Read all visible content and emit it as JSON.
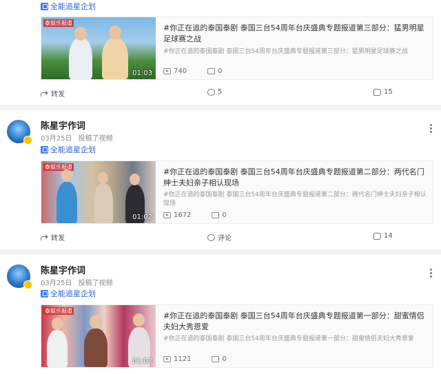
{
  "posts": [
    {
      "topic": "全能追星企划",
      "video": {
        "duration": "01:03",
        "title": "#你正在追的泰国泰剧 泰国三台54周年台庆盛典专题报道第三部分：猛男明星足球赛之战",
        "subtitle": "#你正在追的泰国泰剧 泰国三台54周年台庆盛典专题报道第三部分：猛男明星足球赛之战",
        "plays": "740",
        "danmaku": "0",
        "thumb_tag": "泰娱乐报道"
      },
      "actions": {
        "share": "转发",
        "comment": "5",
        "like": "15"
      }
    },
    {
      "author": "陈星宇作词",
      "date": "03月25日",
      "source": "投稿了视频",
      "topic": "全能追星企划",
      "video": {
        "duration": "01:02",
        "title": "#你正在追的泰国泰剧 泰国三台54周年台庆盛典专题报道第二部分：两代名门绅士夫妇亲子相认现场",
        "subtitle": "#你正在追的泰国泰剧 泰国三台54周年台庆盛典专题报道第二部分：两代名门绅士夫妇亲子相认现场",
        "plays": "1672",
        "danmaku": "0",
        "thumb_tag": "泰娱乐报道"
      },
      "actions": {
        "share": "转发",
        "comment": "评论",
        "like": "14"
      }
    },
    {
      "author": "陈星宇作词",
      "date": "03月25日",
      "source": "投稿了视频",
      "topic": "全能追星企划",
      "video": {
        "duration": "01:03",
        "title": "#你正在追的泰国泰剧 泰国三台54周年台庆盛典专题报道第一部分：甜蜜情侣夫妇大秀恩爱",
        "subtitle": "#你正在追的泰国泰剧 泰国三台54周年台庆盛典专题报道第一部分：甜蜜情侣夫妇大秀恩爱",
        "plays": "1121",
        "danmaku": "0",
        "thumb_tag": "泰娱乐报道"
      }
    }
  ],
  "colors": {
    "topic": "#2c67c9",
    "accent_badge": "#ffc400",
    "page_bg": "#f2f3f5"
  },
  "icons": [
    "topic-icon",
    "play-icon",
    "danmaku-icon",
    "share-icon",
    "comment-icon",
    "like-icon",
    "more-icon"
  ]
}
